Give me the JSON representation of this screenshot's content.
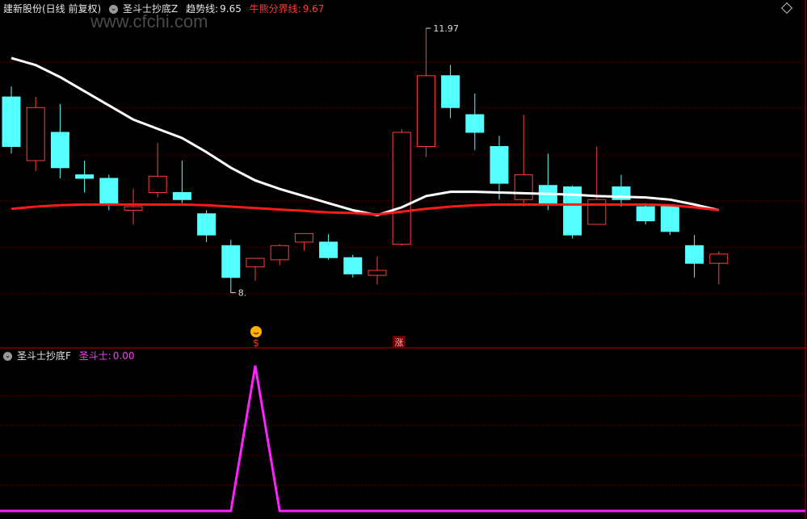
{
  "top_panel": {
    "stock_name": "建新股份(日线 前复权)",
    "indicator_name": "圣斗士抄底Z",
    "trend_label": "趋势线:",
    "trend_value": "9.65",
    "bull_bear_label": "牛熊分界线:",
    "bull_bear_value": "9.67",
    "max_label": "11.97",
    "min_label": "8.",
    "signal_buy_mark": "$",
    "signal_up_mark": "涨",
    "toggle_icon": "chevron-down-icon",
    "settings_icon": "diamond-icon"
  },
  "bottom_panel": {
    "indicator_name": "圣斗士抄底F",
    "series_label": "圣斗士:",
    "series_value": "0.00"
  },
  "watermark": "www.cfchi.com",
  "colors": {
    "up": "#ff3c3c",
    "down": "#54ffff",
    "trend_line": "#ffffff",
    "bull_bear_line": "#ff1a1a",
    "signal": "#ff22ff",
    "grid": "#7a0000"
  },
  "chart_data": {
    "type": "candlestick",
    "y_range": [
      7.9,
      12.05
    ],
    "candles": [
      {
        "o": 11.0,
        "h": 11.15,
        "l": 10.2,
        "c": 10.3
      },
      {
        "o": 10.1,
        "h": 11.0,
        "l": 9.95,
        "c": 10.85
      },
      {
        "o": 10.5,
        "h": 10.9,
        "l": 9.85,
        "c": 10.0
      },
      {
        "o": 9.9,
        "h": 10.1,
        "l": 9.65,
        "c": 9.85
      },
      {
        "o": 9.85,
        "h": 9.9,
        "l": 9.4,
        "c": 9.5
      },
      {
        "o": 9.4,
        "h": 9.7,
        "l": 9.2,
        "c": 9.45
      },
      {
        "o": 9.65,
        "h": 10.35,
        "l": 9.58,
        "c": 9.88
      },
      {
        "o": 9.65,
        "h": 10.1,
        "l": 9.5,
        "c": 9.55
      },
      {
        "o": 9.35,
        "h": 9.4,
        "l": 8.95,
        "c": 9.05
      },
      {
        "o": 8.9,
        "h": 8.98,
        "l": 8.28,
        "c": 8.45
      },
      {
        "o": 8.6,
        "h": 8.72,
        "l": 8.4,
        "c": 8.72
      },
      {
        "o": 8.7,
        "h": 8.92,
        "l": 8.62,
        "c": 8.9
      },
      {
        "o": 8.95,
        "h": 9.07,
        "l": 8.83,
        "c": 9.07
      },
      {
        "o": 8.95,
        "h": 9.06,
        "l": 8.7,
        "c": 8.73
      },
      {
        "o": 8.73,
        "h": 8.77,
        "l": 8.45,
        "c": 8.5
      },
      {
        "o": 8.48,
        "h": 8.75,
        "l": 8.35,
        "c": 8.55
      },
      {
        "o": 8.92,
        "h": 10.55,
        "l": 8.9,
        "c": 10.5
      },
      {
        "o": 10.3,
        "h": 11.97,
        "l": 10.15,
        "c": 11.3
      },
      {
        "o": 11.3,
        "h": 11.45,
        "l": 10.7,
        "c": 10.85
      },
      {
        "o": 10.75,
        "h": 11.05,
        "l": 10.25,
        "c": 10.5
      },
      {
        "o": 10.3,
        "h": 10.45,
        "l": 9.55,
        "c": 9.78
      },
      {
        "o": 9.55,
        "h": 10.75,
        "l": 9.45,
        "c": 9.9
      },
      {
        "o": 9.75,
        "h": 10.2,
        "l": 9.4,
        "c": 9.5
      },
      {
        "o": 9.73,
        "h": 9.75,
        "l": 9.0,
        "c": 9.05
      },
      {
        "o": 9.2,
        "h": 10.3,
        "l": 9.2,
        "c": 9.55
      },
      {
        "o": 9.73,
        "h": 9.9,
        "l": 9.45,
        "c": 9.55
      },
      {
        "o": 9.45,
        "h": 9.5,
        "l": 9.2,
        "c": 9.25
      },
      {
        "o": 9.45,
        "h": 9.45,
        "l": 9.05,
        "c": 9.1
      },
      {
        "o": 8.9,
        "h": 9.05,
        "l": 8.45,
        "c": 8.65
      },
      {
        "o": 8.65,
        "h": 8.82,
        "l": 8.35,
        "c": 8.78
      }
    ],
    "trend_line": [
      11.55,
      11.45,
      11.28,
      11.08,
      10.88,
      10.68,
      10.55,
      10.42,
      10.22,
      10.0,
      9.82,
      9.7,
      9.6,
      9.5,
      9.4,
      9.33,
      9.44,
      9.6,
      9.66,
      9.66,
      9.65,
      9.64,
      9.63,
      9.62,
      9.6,
      9.59,
      9.58,
      9.55,
      9.48,
      9.4
    ],
    "bull_bear_line": [
      9.42,
      9.45,
      9.47,
      9.48,
      9.48,
      9.48,
      9.48,
      9.48,
      9.47,
      9.45,
      9.43,
      9.41,
      9.39,
      9.37,
      9.36,
      9.34,
      9.38,
      9.42,
      9.45,
      9.47,
      9.48,
      9.48,
      9.48,
      9.48,
      9.48,
      9.48,
      9.48,
      9.47,
      9.44,
      9.4
    ],
    "signal_series": [
      0,
      0,
      0,
      0,
      0,
      0,
      0,
      0,
      0,
      0,
      1,
      0,
      0,
      0,
      0,
      0,
      0,
      0,
      0,
      0,
      0,
      0,
      0,
      0,
      0,
      0,
      0,
      0,
      0,
      0
    ]
  }
}
